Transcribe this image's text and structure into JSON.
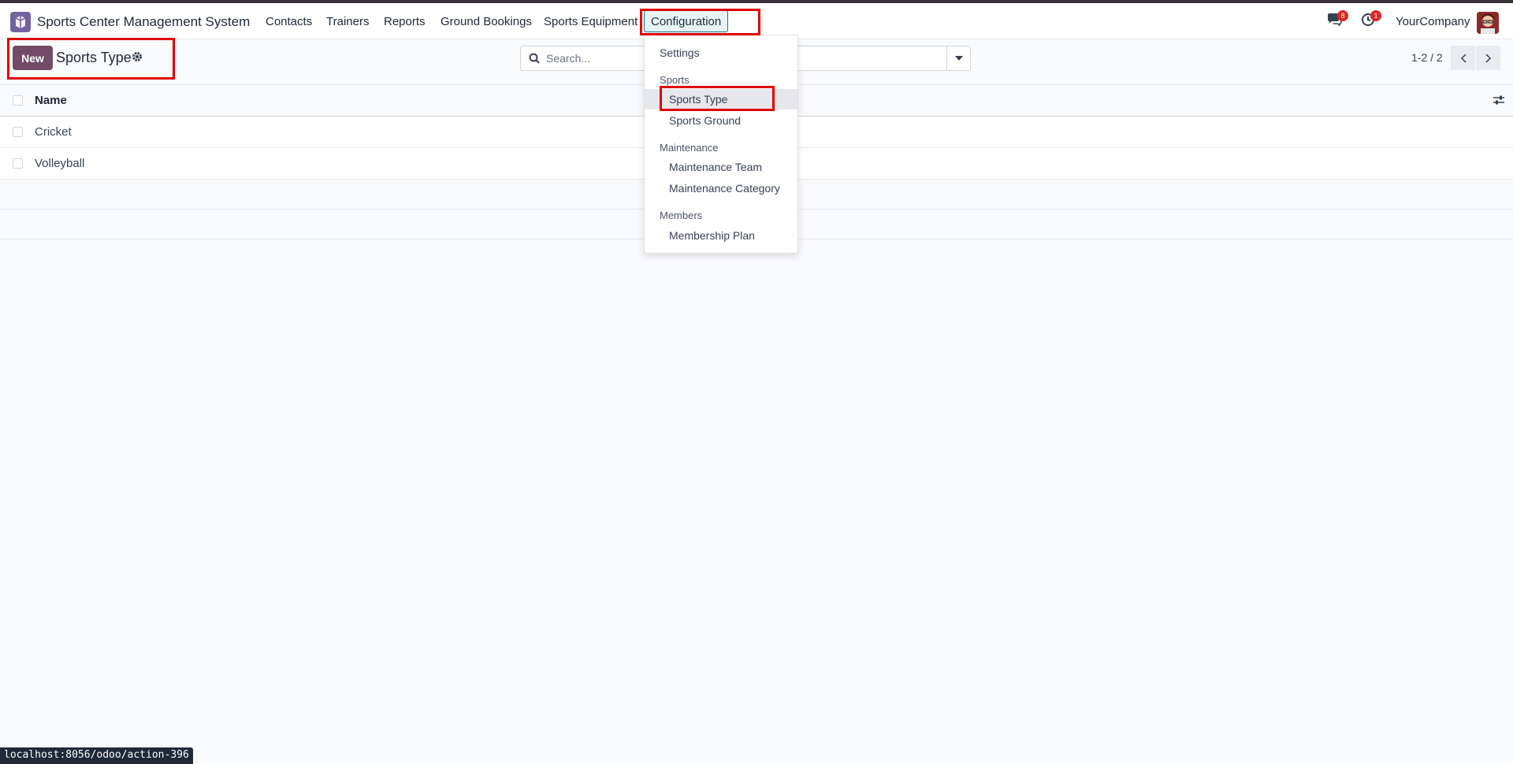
{
  "navbar": {
    "app_name": "Sports Center Management System",
    "menu": [
      "Contacts",
      "Trainers",
      "Reports",
      "Ground Bookings",
      "Sports Equipment",
      "Configuration"
    ],
    "messages_badge": "8",
    "activities_badge": "1",
    "company": "YourCompany"
  },
  "control_panel": {
    "new_label": "New",
    "title": "Sports Type",
    "search_placeholder": "Search...",
    "pager": "1-2 / 2"
  },
  "list": {
    "column_header": "Name",
    "rows": [
      "Cricket",
      "Volleyball"
    ]
  },
  "dropdown": {
    "settings": "Settings",
    "sections": [
      {
        "title": "Sports",
        "items": [
          "Sports Type",
          "Sports Ground"
        ]
      },
      {
        "title": "Maintenance",
        "items": [
          "Maintenance Team",
          "Maintenance Category"
        ]
      },
      {
        "title": "Members",
        "items": [
          "Membership Plan"
        ]
      }
    ]
  },
  "status_url": "localhost:8056/odoo/action-396",
  "colors": {
    "brand": "#714b67",
    "annotation": "#e00000",
    "badge": "#dc2626"
  }
}
